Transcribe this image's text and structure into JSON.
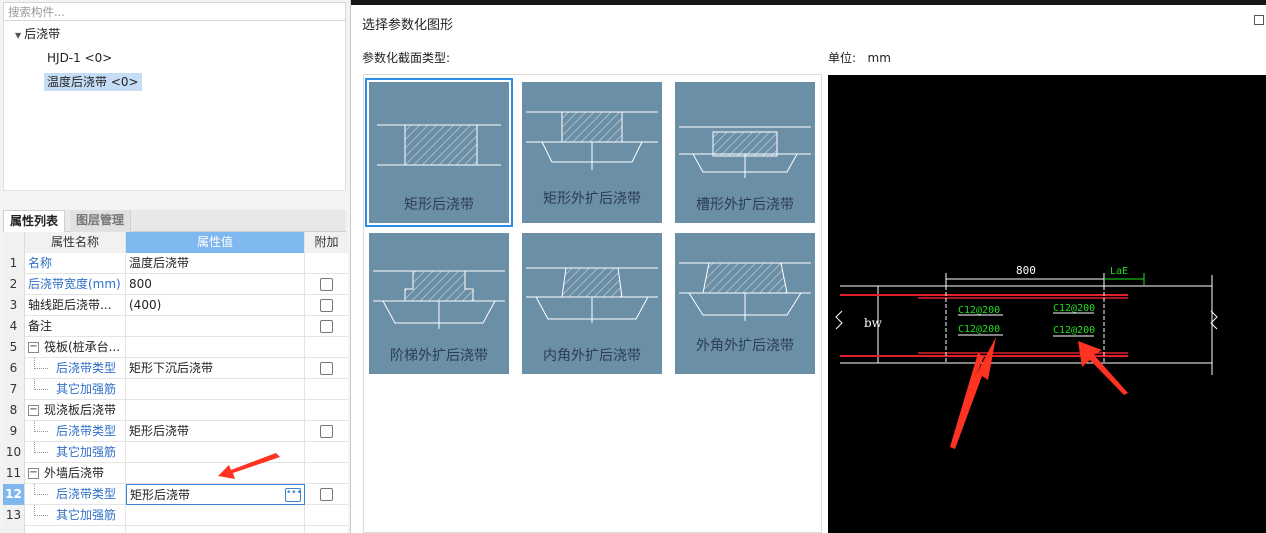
{
  "search": {
    "placeholder": "搜索构件..."
  },
  "tree": {
    "root": "后浇带",
    "children": [
      {
        "label": "HJD-1 <0>",
        "selected": false
      },
      {
        "label": "温度后浇带 <0>",
        "selected": true
      }
    ]
  },
  "tabs": {
    "properties": "属性列表",
    "layers": "图层管理"
  },
  "grid": {
    "headers": {
      "name": "属性名称",
      "value": "属性值",
      "extra": "附加"
    },
    "rows": [
      {
        "idx": "1",
        "name": "名称",
        "value": "温度后浇带"
      },
      {
        "idx": "2",
        "name": "后浇带宽度(mm)",
        "value": "800"
      },
      {
        "idx": "3",
        "name": "轴线距后浇带...",
        "value": "(400)"
      },
      {
        "idx": "4",
        "name": "备注",
        "value": ""
      },
      {
        "idx": "5",
        "name": "筏板(桩承台...",
        "value": ""
      },
      {
        "idx": "6",
        "name": "后浇带类型",
        "value": "矩形下沉后浇带"
      },
      {
        "idx": "7",
        "name": "其它加强筋",
        "value": ""
      },
      {
        "idx": "8",
        "name": "现浇板后浇带",
        "value": ""
      },
      {
        "idx": "9",
        "name": "后浇带类型",
        "value": "矩形后浇带"
      },
      {
        "idx": "10",
        "name": "其它加强筋",
        "value": ""
      },
      {
        "idx": "11",
        "name": "外墙后浇带",
        "value": ""
      },
      {
        "idx": "12",
        "name": "后浇带类型",
        "value": "矩形后浇带"
      },
      {
        "idx": "13",
        "name": "其它加强筋",
        "value": ""
      }
    ],
    "selected_row": "12"
  },
  "dialog": {
    "title": "选择参数化图形",
    "type_label": "参数化截面类型:",
    "unit_label": "单位:",
    "unit_value": "mm",
    "options": [
      {
        "label": "矩形后浇带",
        "selected": true
      },
      {
        "label": "矩形外扩后浇带",
        "selected": false
      },
      {
        "label": "槽形外扩后浇带",
        "selected": false
      },
      {
        "label": "阶梯外扩后浇带",
        "selected": false
      },
      {
        "label": "内角外扩后浇带",
        "selected": false
      },
      {
        "label": "外角外扩后浇带",
        "selected": false
      }
    ]
  },
  "preview": {
    "dim_width": "800",
    "dim_lae": "LaE",
    "label_bw": "bw",
    "rebar_labels": [
      "C12@200",
      "C12@200",
      "C12@200",
      "C12@200"
    ]
  },
  "colors": {
    "selection_blue": "#2a8ee8",
    "header_blue": "#7fb7ef",
    "option_tile": "#6b8fa6",
    "rebar_red": "#e0202a",
    "cad_green": "#22dd22",
    "annotation_red": "#ff3322"
  },
  "icons": [
    "tree-expand-icon",
    "collapse-icon",
    "ellipsis-icon",
    "maximize-icon",
    "annotation-arrow-icon"
  ]
}
